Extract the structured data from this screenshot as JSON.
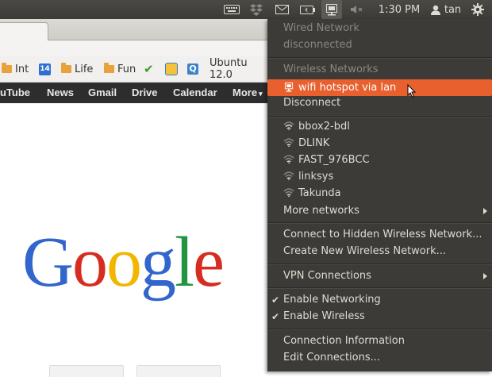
{
  "panel": {
    "time": "1:30 PM",
    "user": "tan",
    "icons": [
      "keyboard-icon",
      "dropbox-icon",
      "mail-icon",
      "battery-icon",
      "network-icon",
      "volume-muted-icon",
      "user-icon",
      "gear-icon"
    ]
  },
  "browser": {
    "bookmarks": [
      "Int",
      "14",
      "Life",
      "Fun",
      "Ubuntu 12.0"
    ],
    "google_bar": [
      "uTube",
      "News",
      "Gmail",
      "Drive",
      "Calendar",
      "More"
    ],
    "logo": [
      "G",
      "o",
      "o",
      "g",
      "l",
      "e"
    ],
    "logo_colors": [
      "#3366cc",
      "#d62d20",
      "#f2b600",
      "#3366cc",
      "#219642",
      "#d62d20"
    ]
  },
  "menu": {
    "wired_header": "Wired Network",
    "wired_status": "disconnected",
    "wireless_header": "Wireless Networks",
    "active_network": "wifi hotspot via lan",
    "disconnect": "Disconnect",
    "networks": [
      "bbox2-bdl",
      "DLINK",
      "FAST_976BCC",
      "linksys",
      "Takunda"
    ],
    "more_networks": "More networks",
    "connect_hidden": "Connect to Hidden Wireless Network...",
    "create_new": "Create New Wireless Network...",
    "vpn": "VPN Connections",
    "enable_networking": "Enable Networking",
    "enable_wireless": "Enable Wireless",
    "connection_info": "Connection Information",
    "edit_connections": "Edit Connections...",
    "highlight_color": "#e9602f"
  }
}
